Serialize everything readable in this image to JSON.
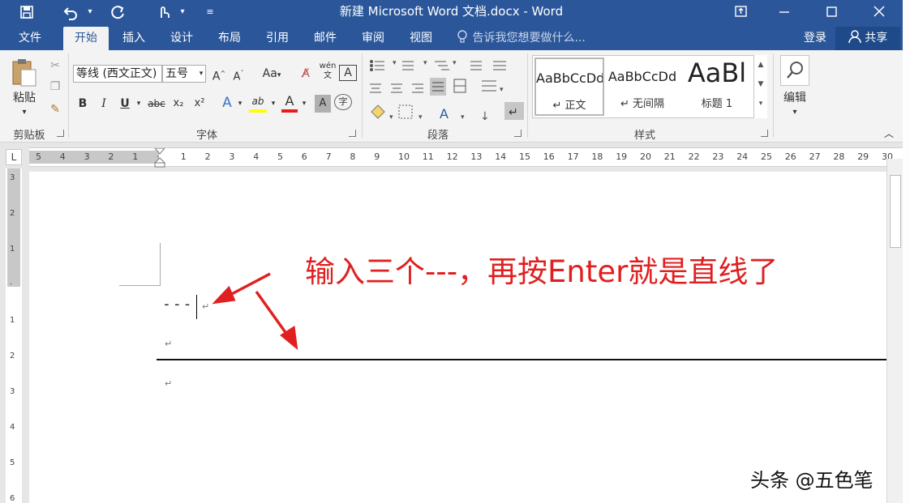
{
  "window": {
    "title": "新建 Microsoft Word 文档.docx - Word"
  },
  "quick_access": {
    "icons": [
      "save-icon",
      "undo-icon",
      "redo-icon",
      "touch-mode-icon",
      "customize-icon"
    ]
  },
  "tabs": [
    "文件",
    "开始",
    "插入",
    "设计",
    "布局",
    "引用",
    "邮件",
    "审阅",
    "视图"
  ],
  "active_tab": "开始",
  "tell_me": "告诉我您想要做什么...",
  "account": {
    "signin": "登录",
    "share": "共享"
  },
  "clipboard": {
    "paste": "粘贴",
    "label": "剪贴板"
  },
  "font": {
    "family": "等线 (西文正文)",
    "size": "五号",
    "label": "字体",
    "case_btn": "Aa",
    "phonetic": "wén",
    "bold": "B",
    "italic": "I",
    "underline": "U",
    "strike": "abc",
    "sub": "x₂",
    "sup": "x²",
    "effects": "A",
    "highlight": "ab",
    "color": "A",
    "shade": "A",
    "enclose": "字"
  },
  "paragraph": {
    "label": "段落"
  },
  "styles": {
    "label": "样式",
    "items": [
      {
        "preview": "AaBbCcDd",
        "name": "↵ 正文"
      },
      {
        "preview": "AaBbCcDd",
        "name": "↵ 无间隔"
      },
      {
        "preview": "AaBl",
        "name": "标题 1"
      }
    ]
  },
  "editing": {
    "label": "编辑"
  },
  "ruler": {
    "marks": [
      "5",
      "4",
      "3",
      "2",
      "1",
      "",
      "1",
      "2",
      "3",
      "4",
      "5",
      "6",
      "7",
      "8",
      "9",
      "10",
      "11",
      "12",
      "13",
      "14",
      "15",
      "16",
      "17",
      "18",
      "19",
      "20",
      "21",
      "22",
      "23",
      "24",
      "25",
      "26",
      "27",
      "28",
      "29",
      "30"
    ],
    "vmarks": [
      "3",
      "2",
      "1",
      "",
      "1",
      "2",
      "3",
      "4",
      "5",
      "6"
    ]
  },
  "document": {
    "typed": "---",
    "para_mark": "↵"
  },
  "annotation": "输入三个---，再按Enter就是直线了",
  "watermark": "头条 @五色笔",
  "colors": {
    "title_bar": "#2b579a",
    "annotation": "#e02020",
    "font_color_bar": "#e81c1c",
    "highlight_bar": "#ffff00"
  }
}
